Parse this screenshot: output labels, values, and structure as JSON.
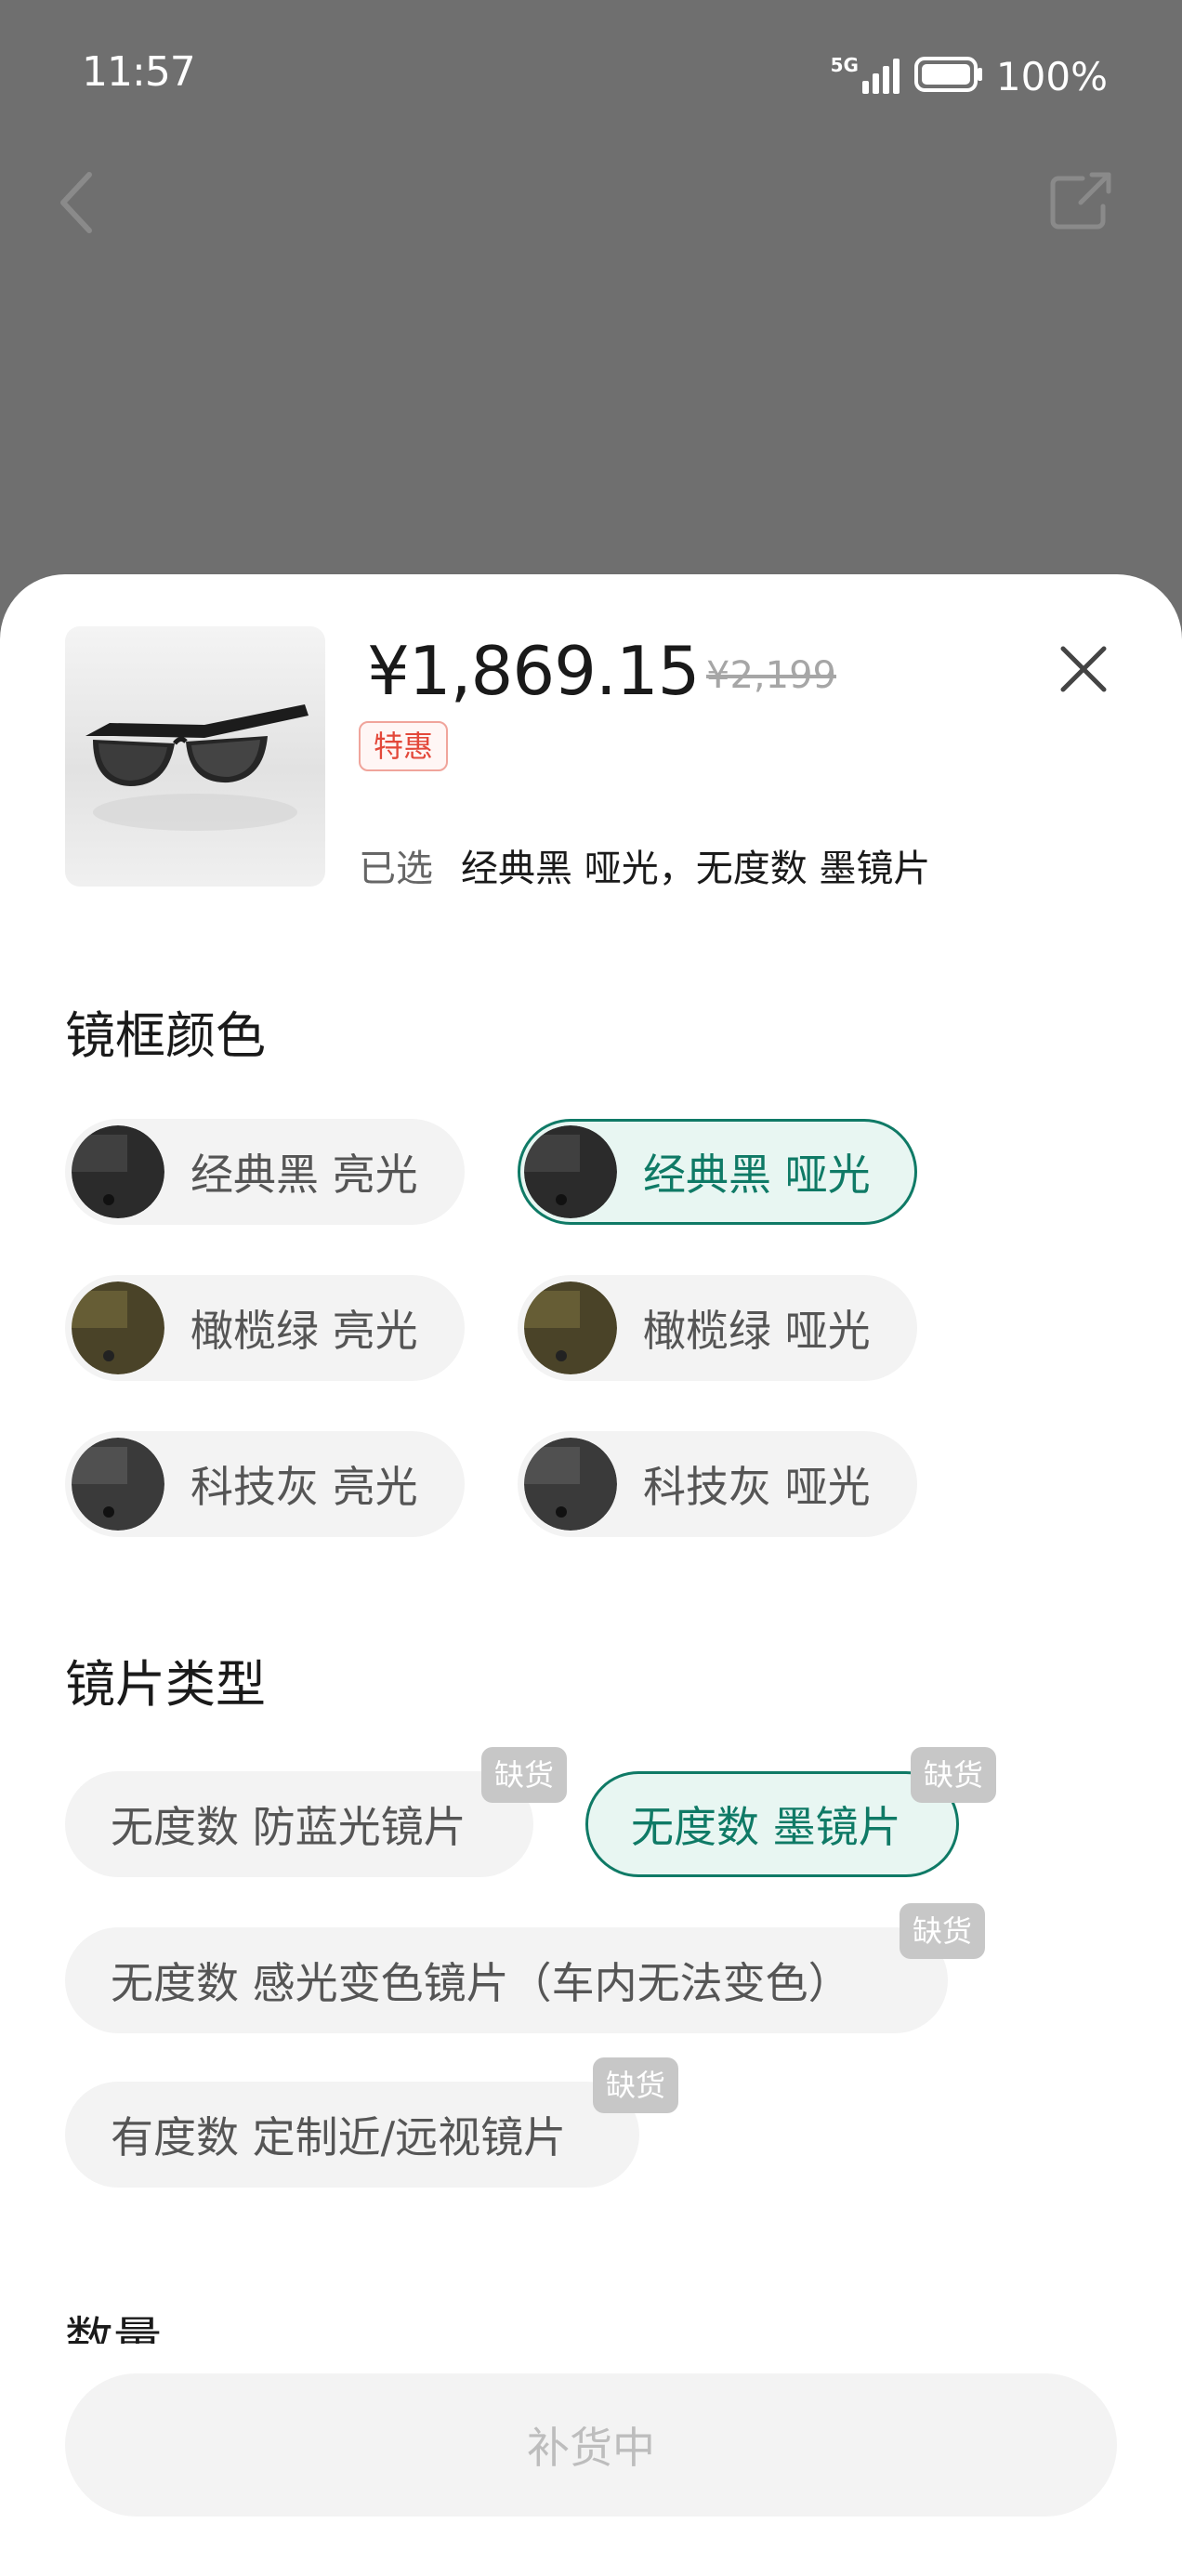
{
  "status_bar": {
    "time": "11:57",
    "network": "5G",
    "battery": "100%"
  },
  "nav": {
    "back_icon": "chevron-left-icon",
    "share_icon": "share-icon"
  },
  "product": {
    "image_icon": "sunglasses-image",
    "price": "¥1,869.15",
    "original_price": "¥2,199",
    "promo_badge": "特惠",
    "selected_label": "已选",
    "selected_value": "经典黑 哑光，无度数 墨镜片"
  },
  "frame_color": {
    "title": "镜框颜色",
    "options": [
      {
        "label": "经典黑 亮光",
        "selected": false,
        "swatch": "#2b2b2b"
      },
      {
        "label": "经典黑 哑光",
        "selected": true,
        "swatch": "#2b2b2b"
      },
      {
        "label": "橄榄绿 亮光",
        "selected": false,
        "swatch": "#4a4328"
      },
      {
        "label": "橄榄绿 哑光",
        "selected": false,
        "swatch": "#4a4328"
      },
      {
        "label": "科技灰 亮光",
        "selected": false,
        "swatch": "#3a3a3a"
      },
      {
        "label": "科技灰 哑光",
        "selected": false,
        "swatch": "#3a3a3a"
      }
    ]
  },
  "lens_type": {
    "title": "镜片类型",
    "options": [
      {
        "label": "无度数 防蓝光镜片",
        "selected": false,
        "badge": "缺货"
      },
      {
        "label": "无度数 墨镜片",
        "selected": true,
        "badge": "缺货"
      },
      {
        "label": "无度数 感光变色镜片（车内无法变色）",
        "selected": false,
        "badge": "缺货"
      },
      {
        "label": "有度数 定制近/远视镜片",
        "selected": false,
        "badge": "缺货"
      }
    ]
  },
  "quantity": {
    "title": "数量"
  },
  "footer": {
    "restock_label": "补货中"
  },
  "colors": {
    "accent": "#0f7a66",
    "accent_bg": "#e8f6f2",
    "promo_red": "#e3483a",
    "overlay": "#6f6f6f"
  }
}
